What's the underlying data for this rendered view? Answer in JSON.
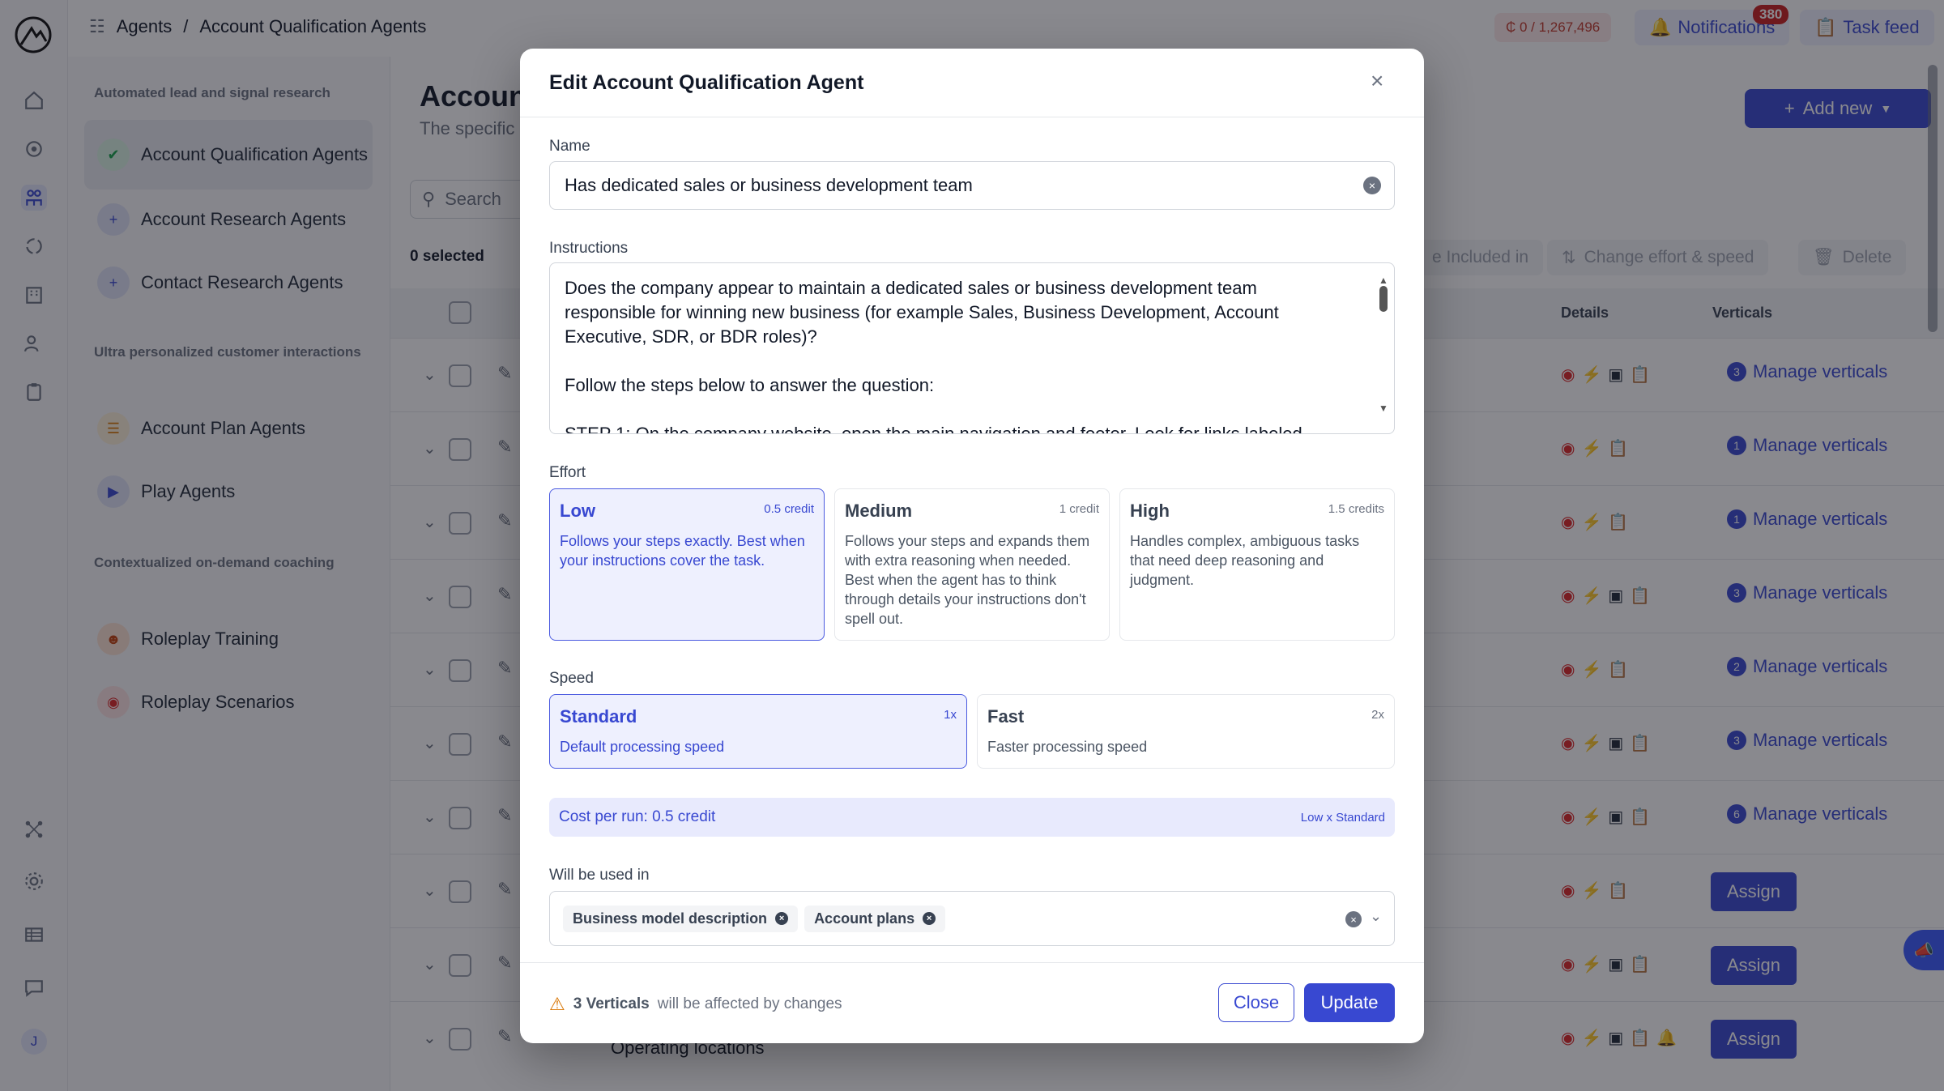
{
  "topbar": {
    "breadcrumb_root": "Agents",
    "breadcrumb_sep": "/",
    "breadcrumb_current": "Account Qualification Agents",
    "credits": "₵ 0 / 1,267,496",
    "notifications_label": "Notifications",
    "notifications_count": "380",
    "task_feed_label": "Task feed"
  },
  "sidebar": {
    "group1": "Automated lead and signal research",
    "group2": "Ultra personalized customer interactions",
    "group3": "Contextualized on-demand coaching",
    "items": [
      {
        "label": "Account Qualification Agents"
      },
      {
        "label": "Account Research Agents"
      },
      {
        "label": "Contact Research Agents"
      },
      {
        "label": "Account Plan Agents"
      },
      {
        "label": "Play Agents"
      },
      {
        "label": "Roleplay Training"
      },
      {
        "label": "Roleplay Scenarios"
      }
    ],
    "user_initial": "J"
  },
  "main": {
    "title": "Accoun",
    "subtitle": "The specific",
    "add_new": "Add new",
    "search_placeholder": "Search",
    "selected_count": "0 selected",
    "toolbar": {
      "included_in": "e Included in",
      "change_effort": "Change effort & speed",
      "delete": "Delete"
    },
    "columns": {
      "details": "Details",
      "verticals": "Verticals"
    },
    "manage_label": "Manage verticals",
    "assign_label": "Assign",
    "last_row_name": "Operating locations",
    "rows": [
      {
        "verticals": "3"
      },
      {
        "verticals": "1"
      },
      {
        "verticals": "1"
      },
      {
        "verticals": "3"
      },
      {
        "verticals": "2"
      },
      {
        "verticals": "3"
      },
      {
        "verticals": "6"
      }
    ]
  },
  "modal": {
    "title": "Edit Account Qualification Agent",
    "name_label": "Name",
    "name_value": "Has dedicated sales or business development team",
    "instructions_label": "Instructions",
    "instructions_line1": "Does the company appear to maintain a dedicated sales or business development team",
    "instructions_line2": "responsible for winning new business (for example Sales, Business Development, Account",
    "instructions_line3": "Executive, SDR, or BDR roles)?",
    "instructions_line4": "Follow the steps below to answer the question:",
    "instructions_line5": "STEP 1: On the company website, open the main navigation and footer. Look for links labeled",
    "effort_label": "Effort",
    "effort": [
      {
        "title": "Low",
        "cost": "0.5 credit",
        "desc": "Follows your steps exactly. Best when your instructions cover the task."
      },
      {
        "title": "Medium",
        "cost": "1 credit",
        "desc": "Follows your steps and expands them with extra reasoning when needed. Best when the agent has to think through details your instructions don't spell out."
      },
      {
        "title": "High",
        "cost": "1.5 credits",
        "desc": "Handles complex, ambiguous tasks that need deep reasoning and judgment."
      }
    ],
    "speed_label": "Speed",
    "speed": [
      {
        "title": "Standard",
        "mult": "1x",
        "desc": "Default processing speed"
      },
      {
        "title": "Fast",
        "mult": "2x",
        "desc": "Faster processing speed"
      }
    ],
    "cost_text": "Cost per run: 0.5 credit",
    "cost_formula": "Low x Standard",
    "used_in_label": "Will be used in",
    "used_in": [
      "Business model description",
      "Account plans"
    ],
    "warning_bold": "3 Verticals",
    "warning_rest": "will be affected by changes",
    "close_btn": "Close",
    "update_btn": "Update"
  }
}
